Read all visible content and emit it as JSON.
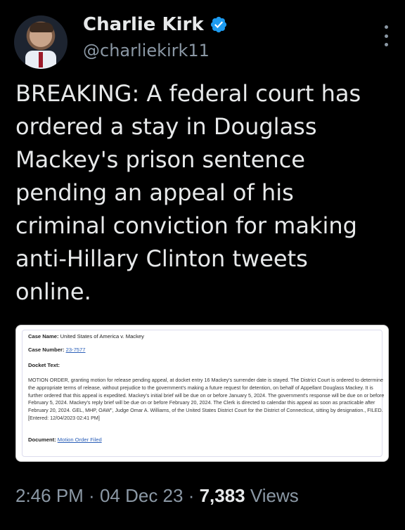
{
  "author": {
    "name": "Charlie Kirk",
    "handle": "@charliekirk11",
    "verified_color": "#1d9bf0"
  },
  "tweet": {
    "text": "BREAKING: A federal court has ordered a stay in Douglass Mackey's prison sentence pending an appeal of his criminal conviction for making anti-Hillary Clinton tweets online."
  },
  "document": {
    "case_name_label": "Case Name:",
    "case_name_value": "United States of America v. Mackey",
    "case_number_label": "Case Number:",
    "case_number_value": "23-7577",
    "docket_text_label": "Docket Text:",
    "docket_text": "MOTION ORDER, granting motion for release pending appeal, at docket entry 16 Mackey's surrender date is stayed. The District Court is ordered to determine the appropriate terms of release, without prejudice to the government's making a future request for detention, on behalf of Appellant Douglass Mackey. It is further ordered that this appeal is expedited. Mackey's initial brief will be due on or before January 5, 2024. The government's response will be due on or before February 5, 2024. Mackey's reply brief will be due on or before February 20, 2024. The Clerk is directed to calendar this appeal as soon as practicable after February 20, 2024. GEL, MHP, OAW\", Judge Omar A. Williams, of the United States District Court for the District of Connecticut, sitting by designation., FILED. [Entered: 12/04/2023 02:41 PM]",
    "document_label": "Document:",
    "document_link": "Motion Order Filed"
  },
  "meta": {
    "time": "2:46 PM",
    "sep1": " · ",
    "date": "04 Dec 23",
    "sep2": " · ",
    "views_count": "7,383",
    "views_label": " Views"
  }
}
